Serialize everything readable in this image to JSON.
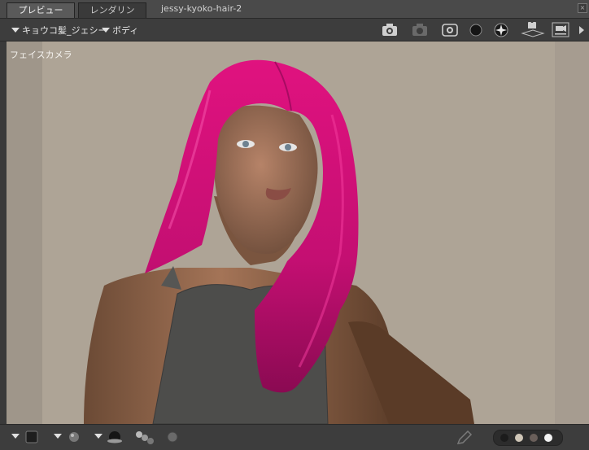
{
  "tabs": [
    {
      "label": "プレビュー",
      "active": true
    },
    {
      "label": "レンダリング",
      "active": false
    }
  ],
  "document_title": "jessy-kyoko-hair-2",
  "toolbar": {
    "figure_dropdown": "キョウコ髪_ジェシー",
    "part_dropdown": "ボディ",
    "icons": [
      "camera-icon",
      "camera-disabled-icon",
      "camera-frame-icon",
      "sphere-icon",
      "light-sphere-icon",
      "camera-view-icon",
      "camera-panel-icon",
      "chevron-right-icon"
    ]
  },
  "viewport": {
    "camera_label": "フェイスカメラ",
    "hair_color": "#e0127f",
    "background_color": "#aea496"
  },
  "bottombar": {
    "icons": [
      "square-icon",
      "sphere-icon",
      "shaded-sphere-icon",
      "multi-sphere-icon",
      "small-sphere-icon",
      "pencil-icon"
    ],
    "swatch_colors": [
      "#1c1c1c",
      "#cfc6b7",
      "#6a5f5a",
      "#f2f2f2"
    ]
  }
}
